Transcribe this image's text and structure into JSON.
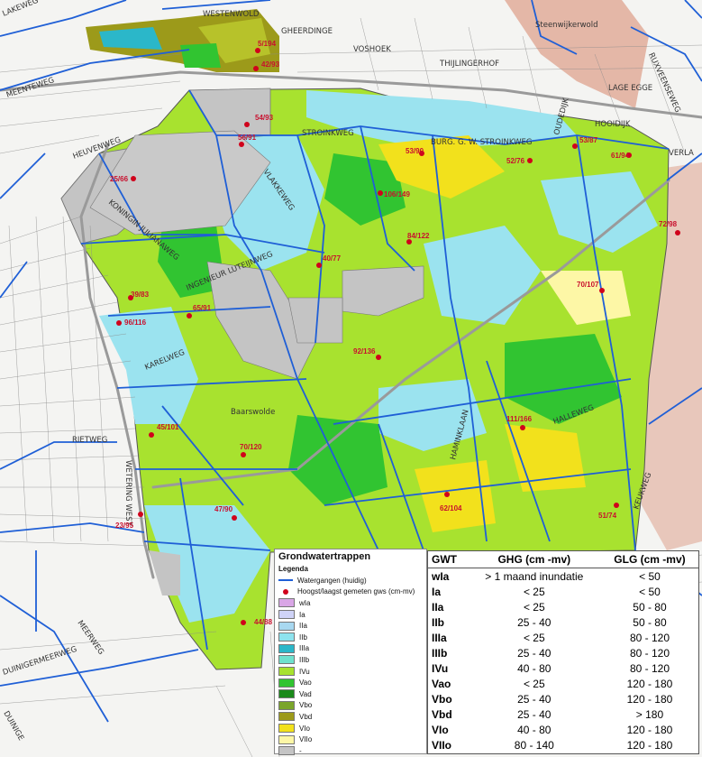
{
  "streets": [
    "LAKEWEG",
    "WESTENWOLD",
    "GHEERDINGE",
    "VOSHOEK",
    "Steenwijkerwold",
    "THIJLINGERHOF",
    "RUXVEENSEWEG",
    "LAGE EGGE",
    "HOOIDIJK",
    "MEENTEWEG",
    "HEUVENWEG",
    "KONINGIN JULIANAWEG",
    "INGENIEUR LUTEIJNWEG",
    "BURG. G. W. STROINKWEG",
    "STROINKWEG",
    "VERLA",
    "VLAKKEWEG",
    "KARELWEG",
    "Baarswolde",
    "RIETWEG",
    "WETERING WEST",
    "DUINIGERMEERWEG",
    "MEERWEG",
    "DUINIGE",
    "HAMINKLAAN",
    "HALLEWEG",
    "KEUKWEG",
    "OUDEDIJK"
  ],
  "measurements": [
    "5/194",
    "42/93",
    "54/93",
    "56/91",
    "53/90",
    "53/87",
    "52/76",
    "61/94",
    "25/66",
    "106/149",
    "84/122",
    "72/98",
    "40/77",
    "39/83",
    "70/107",
    "65/91",
    "96/116",
    "92/136",
    "45/101",
    "111/166",
    "70/120",
    "47/90",
    "62/104",
    "51/74",
    "23/95",
    "44/88"
  ],
  "legend": {
    "title": "Grondwatertrappen",
    "subtitle": "Legenda",
    "watergangen": "Watergangen (huidig)",
    "gws": "Hoogst/laagst gemeten gws (cm-mv)",
    "classes": [
      {
        "label": "wIa",
        "color": "#d9a6e6"
      },
      {
        "label": "Ia",
        "color": "#cfd3f7"
      },
      {
        "label": "IIa",
        "color": "#a8d8f0"
      },
      {
        "label": "IIb",
        "color": "#8ee3ee"
      },
      {
        "label": "IIIa",
        "color": "#2bb7c9"
      },
      {
        "label": "IIIb",
        "color": "#6fe1ce"
      },
      {
        "label": "IVu",
        "color": "#a8e22f"
      },
      {
        "label": "Vao",
        "color": "#31c431"
      },
      {
        "label": "Vad",
        "color": "#1a8a1a"
      },
      {
        "label": "Vbo",
        "color": "#7aa52a"
      },
      {
        "label": "Vbd",
        "color": "#9c9a1a"
      },
      {
        "label": "VIo",
        "color": "#f2e11c"
      },
      {
        "label": "VIIo",
        "color": "#fdf7a6"
      },
      {
        "label": "-",
        "color": "#c4c4c4"
      }
    ]
  },
  "table": {
    "headers": [
      "GWT",
      "GHG (cm -mv)",
      "GLG (cm -mv)"
    ],
    "rows": [
      [
        "wIa",
        "> 1 maand inundatie",
        "< 50"
      ],
      [
        "Ia",
        "< 25",
        "< 50"
      ],
      [
        "IIa",
        "< 25",
        "50 - 80"
      ],
      [
        "IIb",
        "25 - 40",
        "50 - 80"
      ],
      [
        "IIIa",
        "< 25",
        "80 - 120"
      ],
      [
        "IIIb",
        "25 - 40",
        "80 - 120"
      ],
      [
        "IVu",
        "40 - 80",
        "80 - 120"
      ],
      [
        "Vao",
        "< 25",
        "120 - 180"
      ],
      [
        "Vbo",
        "25 - 40",
        "120 - 180"
      ],
      [
        "Vbd",
        "25 - 40",
        "> 180"
      ],
      [
        "VIo",
        "40 - 80",
        "120 - 180"
      ],
      [
        "VIIo",
        "80 - 140",
        "120 - 180"
      ]
    ]
  },
  "colors": {
    "water": "#1f5fd6",
    "urban": "#e6b8a8",
    "unmapped": "#c4c4c4",
    "wet": "#a8e6f2",
    "mid": "#a8e22f",
    "dry": "#f2e11c",
    "dot": "#d0021b"
  }
}
